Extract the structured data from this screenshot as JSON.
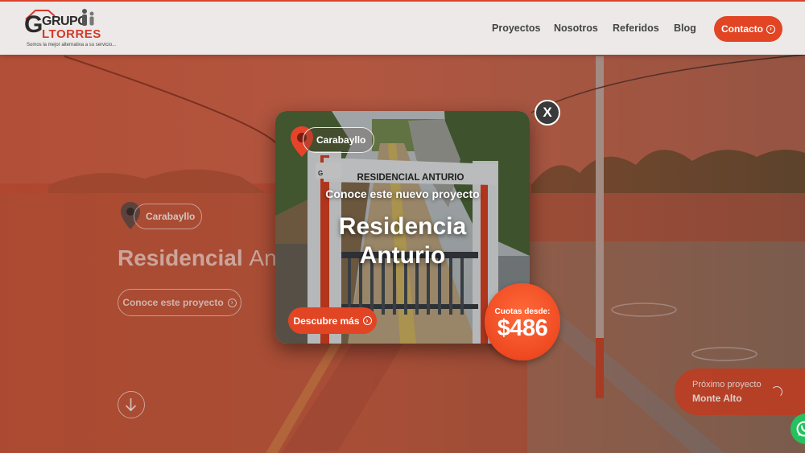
{
  "brand": {
    "name_part1": "GRUPO",
    "name_part2": "LTORRES",
    "tagline": "Somos la mejor alternativa a su servicio..."
  },
  "nav": {
    "items": [
      "Proyectos",
      "Nosotros",
      "Referidos",
      "Blog"
    ],
    "contact_label": "Contacto"
  },
  "hero": {
    "location": "Carabayllo",
    "title_bold": "Residencial",
    "title_thin": "An",
    "cta_label": "Conoce este proyecto"
  },
  "next_project": {
    "label": "Próximo proyecto",
    "name": "Monte Alto"
  },
  "modal": {
    "location": "Carabayllo",
    "sign_text": "RESIDENCIAL ANTURIO",
    "subtitle": "Conoce este nuevo proyecto",
    "title_line1": "Residencia",
    "title_line2": "Anturio",
    "button_label": "Descubre más",
    "close_label": "X",
    "badge_label": "Cuotas desde:",
    "badge_price": "$486"
  },
  "colors": {
    "accent": "#e24524",
    "header_bg": "#eeeeee",
    "whatsapp": "#25c15f"
  },
  "icons": [
    "map-pin-icon",
    "chevron-right-circle-icon",
    "arrow-down-circle-icon",
    "spinner-icon",
    "whatsapp-icon",
    "close-icon"
  ]
}
